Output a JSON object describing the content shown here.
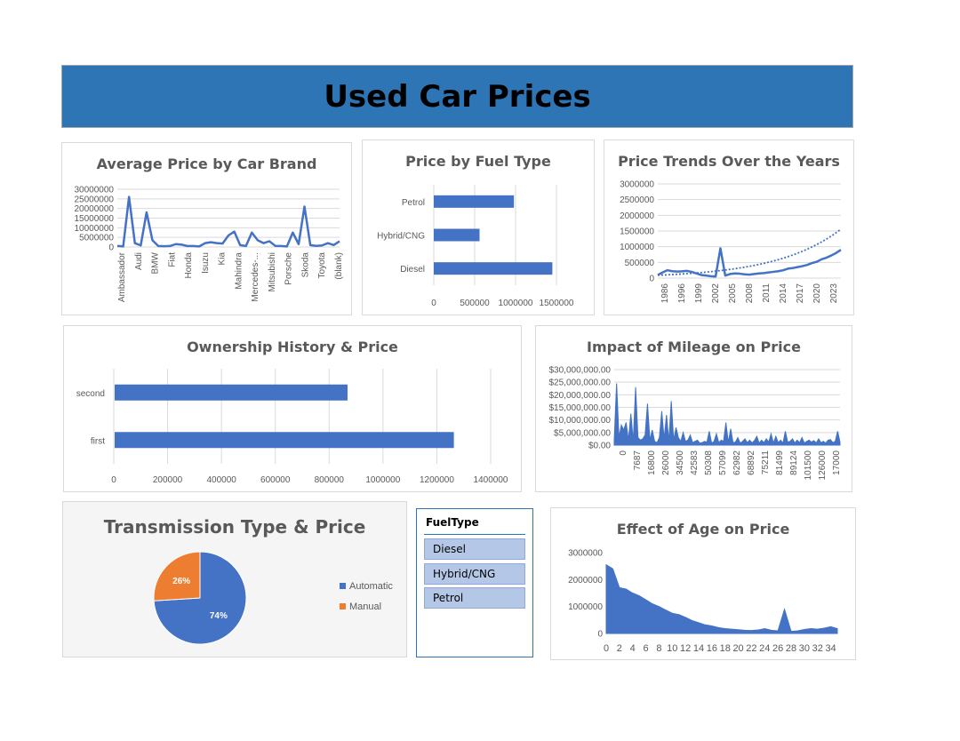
{
  "header": {
    "title": "Used Car Prices"
  },
  "colors": {
    "primary": "#4472c4",
    "orange": "#ed7d31",
    "banner": "#2e75b6"
  },
  "slicer": {
    "header": "FuelType",
    "items": [
      "Diesel",
      "Hybrid/CNG",
      "Petrol"
    ]
  },
  "chart_data": [
    {
      "id": "brand",
      "type": "line",
      "title": "Average Price by Car Brand",
      "ylim": [
        0,
        30000000
      ],
      "yticks": [
        "0",
        "5000000",
        "10000000",
        "15000000",
        "20000000",
        "25000000",
        "30000000"
      ],
      "xtick_labels": [
        "Ambassador",
        "Audi",
        "BMW",
        "Fiat",
        "Honda",
        "Isuzu",
        "Kia",
        "Mahindra",
        "Mercedes-...",
        "Mitsubishi",
        "Porsche",
        "Skoda",
        "Toyota",
        "(blank)"
      ],
      "values": [
        600000,
        300000,
        26000000,
        2000000,
        800000,
        18000000,
        3500000,
        500000,
        400000,
        500000,
        1500000,
        1200000,
        500000,
        500000,
        300000,
        2000000,
        2500000,
        2000000,
        1800000,
        6000000,
        8000000,
        1000000,
        500000,
        7500000,
        3500000,
        2000000,
        3000000,
        600000,
        500000,
        300000,
        7500000,
        1500000,
        21000000,
        1000000,
        600000,
        800000,
        2000000,
        1000000,
        3000000
      ],
      "grid": true
    },
    {
      "id": "fuel",
      "type": "bar",
      "orientation": "horizontal",
      "title": "Price by Fuel Type",
      "categories": [
        "Petrol",
        "Hybrid/CNG",
        "Diesel"
      ],
      "values": [
        980000,
        560000,
        1450000
      ],
      "xlim": [
        0,
        1500000
      ],
      "xticks": [
        "0",
        "500000",
        "1000000",
        "1500000"
      ],
      "grid": true
    },
    {
      "id": "years",
      "type": "line",
      "title": "Price Trends Over the Years",
      "x": [
        1986,
        1987,
        1988,
        1989,
        1990,
        1991,
        1992,
        1993,
        1994,
        1995,
        1996,
        1997,
        1998,
        1999,
        2000,
        2001,
        2002,
        2003,
        2004,
        2005,
        2006,
        2007,
        2008,
        2009,
        2010,
        2011,
        2012,
        2013,
        2014,
        2015,
        2016,
        2017,
        2018,
        2019,
        2020,
        2021,
        2022,
        2023,
        2024
      ],
      "values": [
        100000,
        180000,
        250000,
        220000,
        210000,
        215000,
        230000,
        200000,
        150000,
        100000,
        80000,
        60000,
        50000,
        950000,
        80000,
        130000,
        150000,
        140000,
        120000,
        110000,
        130000,
        150000,
        160000,
        180000,
        200000,
        220000,
        250000,
        300000,
        320000,
        350000,
        380000,
        420000,
        480000,
        520000,
        600000,
        650000,
        720000,
        800000,
        900000
      ],
      "ylim": [
        0,
        3000000
      ],
      "yticks": [
        "0",
        "500000",
        "1000000",
        "1500000",
        "2000000",
        "2500000",
        "3000000"
      ],
      "xtick_labels": [
        "1986",
        "1996",
        "1999",
        "2002",
        "2005",
        "2008",
        "2011",
        "2014",
        "2017",
        "2020",
        "2023"
      ],
      "trendline": "dotted",
      "grid": true
    },
    {
      "id": "owner",
      "type": "bar",
      "orientation": "horizontal",
      "title": "Ownership History & Price",
      "categories": [
        "second",
        "first"
      ],
      "values": [
        865000,
        1260000
      ],
      "xlim": [
        0,
        1400000
      ],
      "xticks": [
        "0",
        "200000",
        "400000",
        "600000",
        "800000",
        "1000000",
        "1200000",
        "1400000"
      ],
      "grid": true
    },
    {
      "id": "mileage",
      "type": "area",
      "title": "Impact of Mileage on Price",
      "ylim": [
        0,
        30000000
      ],
      "yticks": [
        "$0.00",
        "$5,000,000.00",
        "$10,000,000.00",
        "$15,000,000.00",
        "$20,000,000.00",
        "$25,000,000.00",
        "$30,000,000.00"
      ],
      "xtick_labels": [
        "0",
        "7687",
        "16800",
        "26000",
        "34500",
        "42583",
        "50308",
        "57099",
        "62982",
        "68892",
        "75211",
        "81499",
        "89124",
        "101500",
        "126000",
        "17000"
      ],
      "values": [
        2000000,
        24500000,
        3000000,
        8000000,
        6000000,
        9000000,
        2000000,
        12500000,
        1500000,
        23000000,
        3000000,
        2000000,
        2500000,
        4000000,
        16500000,
        2000000,
        6000000,
        1500000,
        1000000,
        3000000,
        13500000,
        2500000,
        12000000,
        1500000,
        17500000,
        2000000,
        7000000,
        3000000,
        1500000,
        5000000,
        1500000,
        2000000,
        4000000,
        1000000,
        1500000,
        2000000,
        800000,
        1000000,
        1500000,
        1200000,
        5500000,
        800000,
        1500000,
        4500000,
        1000000,
        2000000,
        1500000,
        9000000,
        1000000,
        6500000,
        1000000,
        1200000,
        3000000,
        800000,
        1500000,
        2500000,
        1000000,
        2000000,
        900000,
        1800000,
        3500000,
        800000,
        2000000,
        1000000,
        2500000,
        1200000,
        4500000,
        800000,
        3500000,
        1000000,
        2000000,
        800000,
        5500000,
        1200000,
        1500000,
        2500000,
        900000,
        2000000,
        1000000,
        3000000,
        800000,
        1500000,
        2000000,
        1200000,
        1800000,
        900000,
        2500000,
        1000000,
        1500000,
        800000,
        2000000,
        2200000,
        1000000,
        1500000,
        5500000,
        1200000
      ],
      "grid": true
    },
    {
      "id": "transmission",
      "type": "pie",
      "title": "Transmission Type & Price",
      "categories": [
        "Automatic",
        "Manual"
      ],
      "values": [
        74,
        26
      ],
      "labels": [
        "74%",
        "26%"
      ],
      "legend": "right"
    },
    {
      "id": "age",
      "type": "area",
      "title": "Effect of Age on Price",
      "x": [
        0,
        1,
        2,
        3,
        4,
        5,
        6,
        7,
        8,
        9,
        10,
        11,
        12,
        13,
        14,
        15,
        16,
        17,
        18,
        19,
        20,
        21,
        22,
        23,
        24,
        25,
        26,
        27,
        28,
        29,
        30,
        31,
        32,
        33,
        34,
        35
      ],
      "values": [
        2550000,
        2400000,
        1700000,
        1650000,
        1500000,
        1400000,
        1250000,
        1100000,
        1000000,
        870000,
        750000,
        700000,
        600000,
        480000,
        400000,
        320000,
        280000,
        220000,
        180000,
        160000,
        140000,
        120000,
        110000,
        130000,
        180000,
        120000,
        100000,
        900000,
        80000,
        100000,
        150000,
        180000,
        160000,
        200000,
        250000,
        180000
      ],
      "ylim": [
        0,
        3000000
      ],
      "yticks": [
        "0",
        "1000000",
        "2000000",
        "3000000"
      ],
      "xtick_labels": [
        "0",
        "2",
        "4",
        "6",
        "8",
        "10",
        "12",
        "14",
        "16",
        "18",
        "20",
        "22",
        "24",
        "26",
        "28",
        "30",
        "32",
        "34"
      ],
      "grid": false
    }
  ]
}
